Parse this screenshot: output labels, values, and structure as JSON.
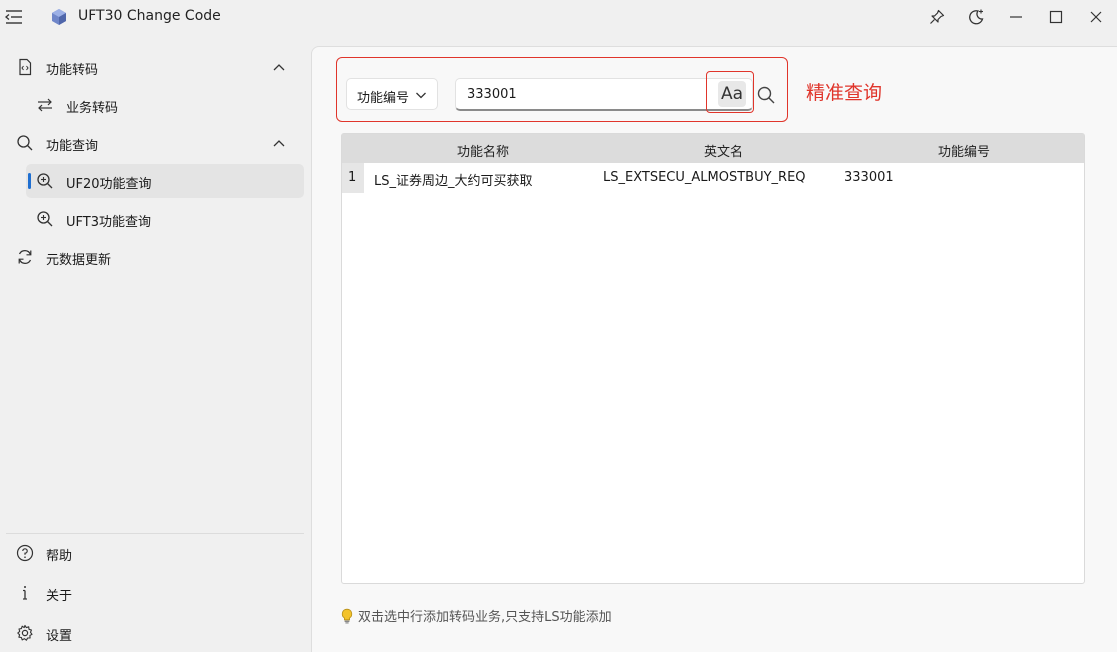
{
  "titlebar": {
    "title": "UFT30 Change Code",
    "icons": [
      "menu-icon",
      "app-cube-icon",
      "pin-icon",
      "theme-icon",
      "minimize-icon",
      "maximize-icon",
      "close-icon"
    ]
  },
  "sidebar": {
    "items": [
      {
        "label": "功能转码",
        "icon": "code-file-icon",
        "expanded": true
      },
      {
        "label": "业务转码",
        "icon": "swap-arrows-icon"
      },
      {
        "label": "功能查询",
        "icon": "search-icon",
        "expanded": true
      },
      {
        "label": "UF20功能查询",
        "icon": "zoom-in-icon",
        "active": true
      },
      {
        "label": "UFT3功能查询",
        "icon": "zoom-in-icon"
      },
      {
        "label": "元数据更新",
        "icon": "refresh-icon"
      }
    ],
    "footer": [
      {
        "label": "帮助",
        "icon": "help-icon"
      },
      {
        "label": "关于",
        "icon": "info-icon"
      },
      {
        "label": "设置",
        "icon": "gear-icon"
      }
    ]
  },
  "search": {
    "field_select": "功能编号",
    "query": "333001",
    "match_case_label": "Aa",
    "annotation": "精准查询"
  },
  "table": {
    "columns": [
      "功能名称",
      "英文名",
      "功能编号"
    ],
    "rows": [
      {
        "index": "1",
        "name": "LS_证券周边_大约可买获取",
        "english": "LS_EXTSECU_ALMOSTBUY_REQ",
        "code": "333001"
      }
    ]
  },
  "hint": "双击选中行添加转码业务,只支持LS功能添加",
  "colors": {
    "accent": "#1f6fd1",
    "annotation": "#e0352b"
  }
}
